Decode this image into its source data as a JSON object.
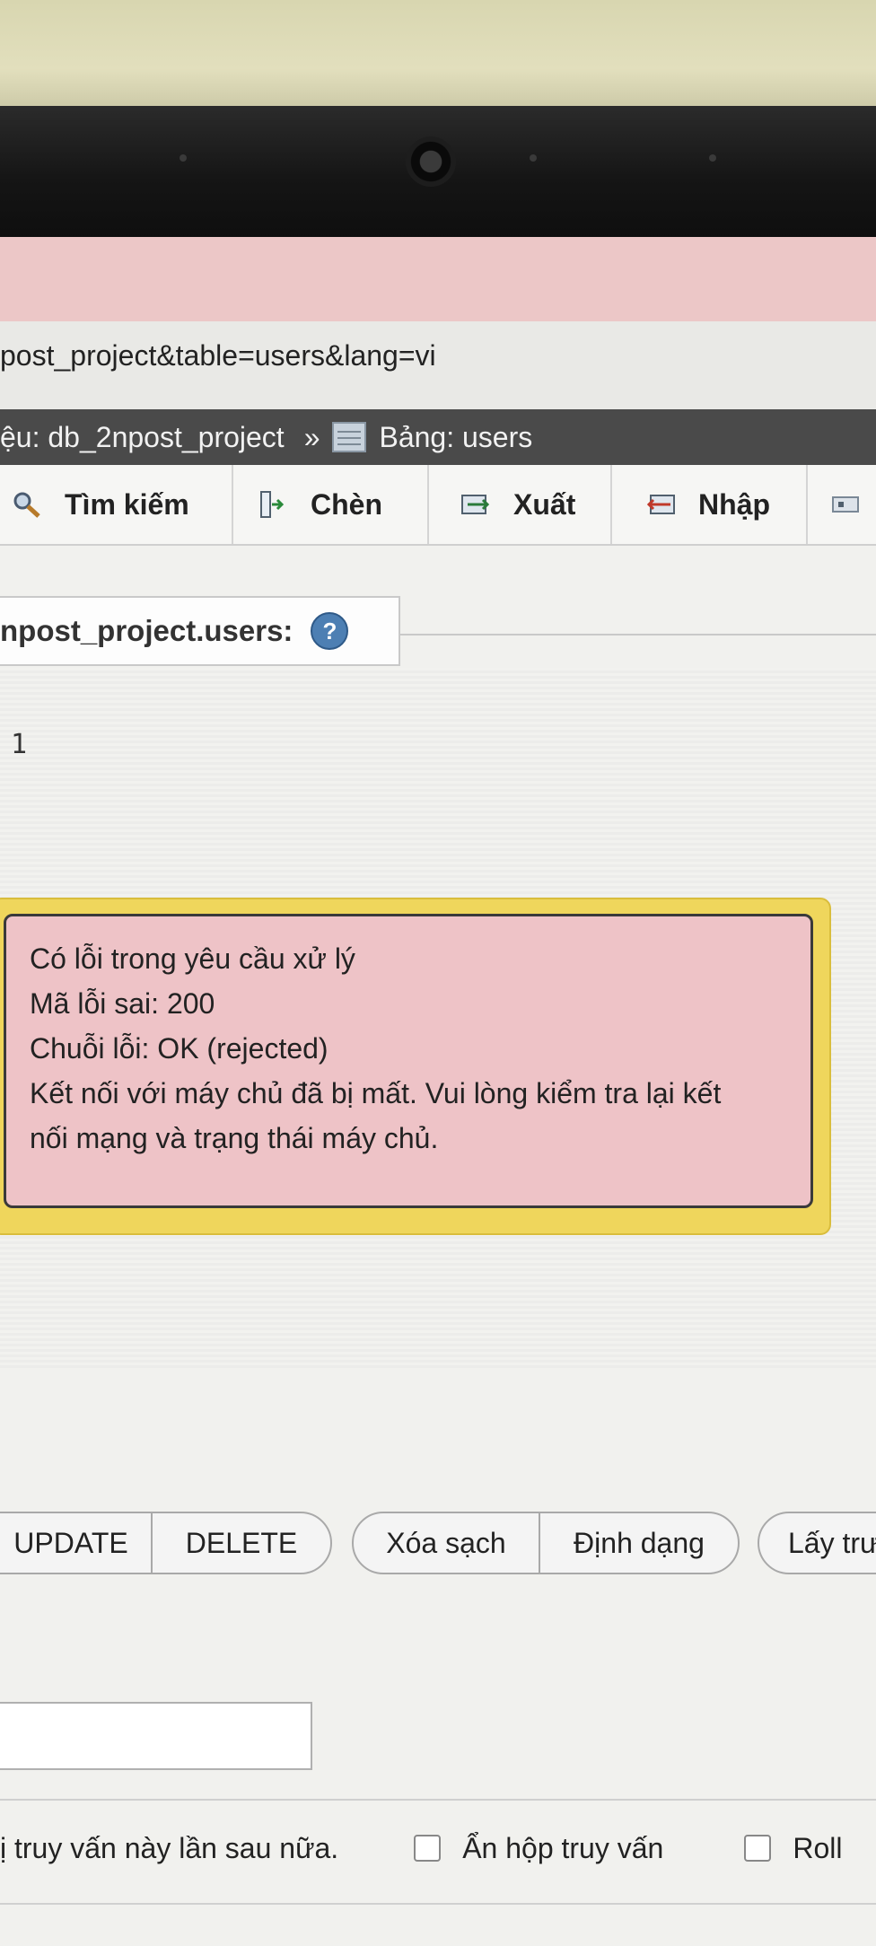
{
  "browser": {
    "url_fragment": "post_project&table=users&lang=vi"
  },
  "breadcrumb": {
    "database": "ệu: db_2npost_project",
    "separator": "»",
    "table": "Bảng: users"
  },
  "toolbar": {
    "tabs": [
      {
        "label": "Tìm kiếm",
        "icon": "search-icon"
      },
      {
        "label": "Chèn",
        "icon": "insert-icon"
      },
      {
        "label": "Xuất",
        "icon": "export-icon"
      },
      {
        "label": "Nhập",
        "icon": "import-icon"
      }
    ]
  },
  "sql": {
    "heading": "npost_project.users:",
    "line_number": "1"
  },
  "error_dialog": {
    "line1": "Có lỗi trong yêu cầu xử lý",
    "line2": "Mã lỗi sai: 200",
    "line3": "Chuỗi lỗi: OK (rejected)",
    "line4": "Kết nối với máy chủ đã bị mất. Vui lòng kiểm tra lại kết",
    "line5": "nối mạng và trạng thái máy chủ."
  },
  "buttons": {
    "update": "UPDATE",
    "delete": "DELETE",
    "clear": "Xóa sạch",
    "format": "Định dạng",
    "get": "Lấy trư"
  },
  "options": {
    "retain_text": "ị truy vấn này lần sau nữa.",
    "hide_box_label": "Ẩn hộp truy vấn",
    "rollback_label": "Roll"
  }
}
